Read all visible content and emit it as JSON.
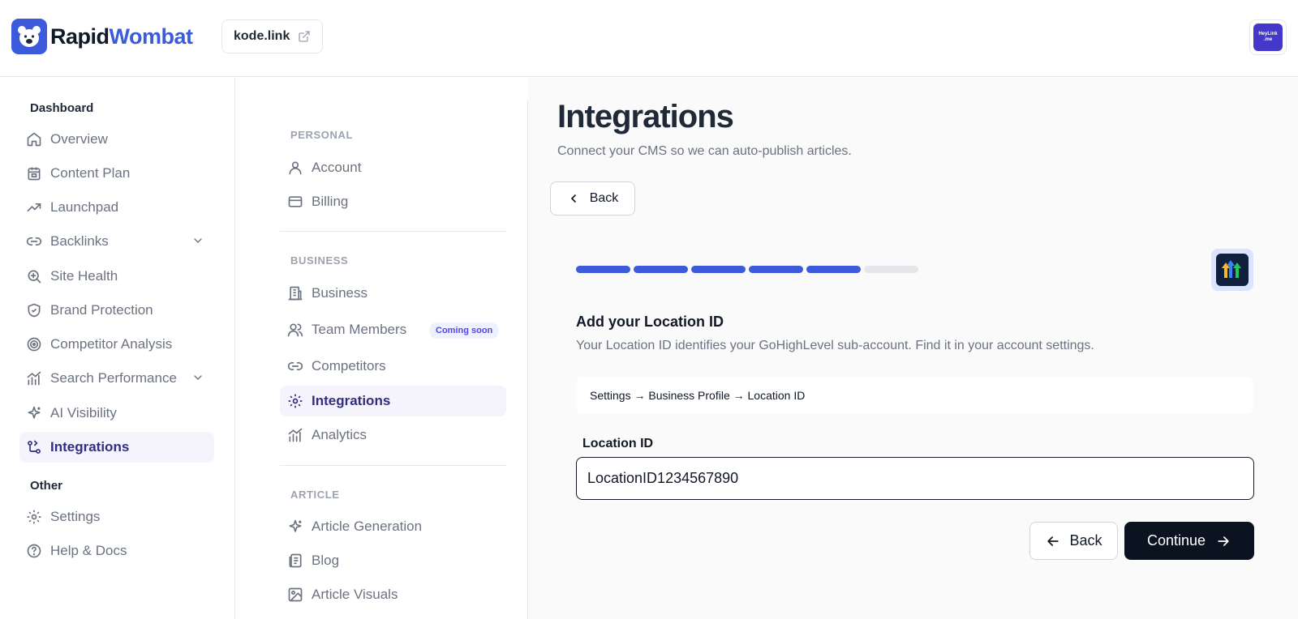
{
  "brand": {
    "name_part1": "Rapid",
    "name_part2": "Wombat"
  },
  "header": {
    "domain": "kode.link",
    "avatar_line1": "HeyLink",
    "avatar_line2": ".me"
  },
  "sidebar": {
    "section_dashboard": "Dashboard",
    "items": [
      {
        "label": "Overview",
        "icon": "home-icon"
      },
      {
        "label": "Content Plan",
        "icon": "calendar-icon"
      },
      {
        "label": "Launchpad",
        "icon": "trending-up-icon"
      },
      {
        "label": "Backlinks",
        "icon": "link-icon"
      },
      {
        "label": "Site Health",
        "icon": "search-health-icon"
      },
      {
        "label": "Brand Protection",
        "icon": "shield-icon"
      },
      {
        "label": "Competitor Analysis",
        "icon": "target-icon"
      },
      {
        "label": "Search Performance",
        "icon": "chart-icon"
      },
      {
        "label": "AI Visibility",
        "icon": "sparkles-icon"
      },
      {
        "label": "Integrations",
        "icon": "git-icon"
      }
    ],
    "section_other": "Other",
    "other_items": [
      {
        "label": "Settings",
        "icon": "gear-icon"
      },
      {
        "label": "Help & Docs",
        "icon": "help-icon"
      }
    ]
  },
  "subnav": {
    "personal_label": "PERSONAL",
    "account": "Account",
    "billing": "Billing",
    "business_label": "BUSINESS",
    "business": "Business",
    "team_members": "Team Members",
    "coming_soon": "Coming soon",
    "competitors": "Competitors",
    "integrations": "Integrations",
    "analytics": "Analytics",
    "article_label": "ARTICLE",
    "article_generation": "Article Generation",
    "blog": "Blog",
    "article_visuals": "Article Visuals"
  },
  "main": {
    "title": "Integrations",
    "subtitle": "Connect your CMS so we can auto-publish articles.",
    "back_top": "Back",
    "progress": {
      "completed": 5,
      "total": 6
    },
    "step_title": "Add your Location ID",
    "step_desc": "Your Location ID identifies your GoHighLevel sub-account. Find it in your account settings.",
    "path_hint": "Settings → Business Profile → Location ID",
    "field_label": "Location ID",
    "field_value": "LocationID1234567890",
    "back_button": "Back",
    "continue_button": "Continue"
  },
  "colors": {
    "accent": "#3b5bdb",
    "primary_dark": "#0b1220",
    "active_bg": "#f5f3fb",
    "active_text": "#312e81"
  }
}
